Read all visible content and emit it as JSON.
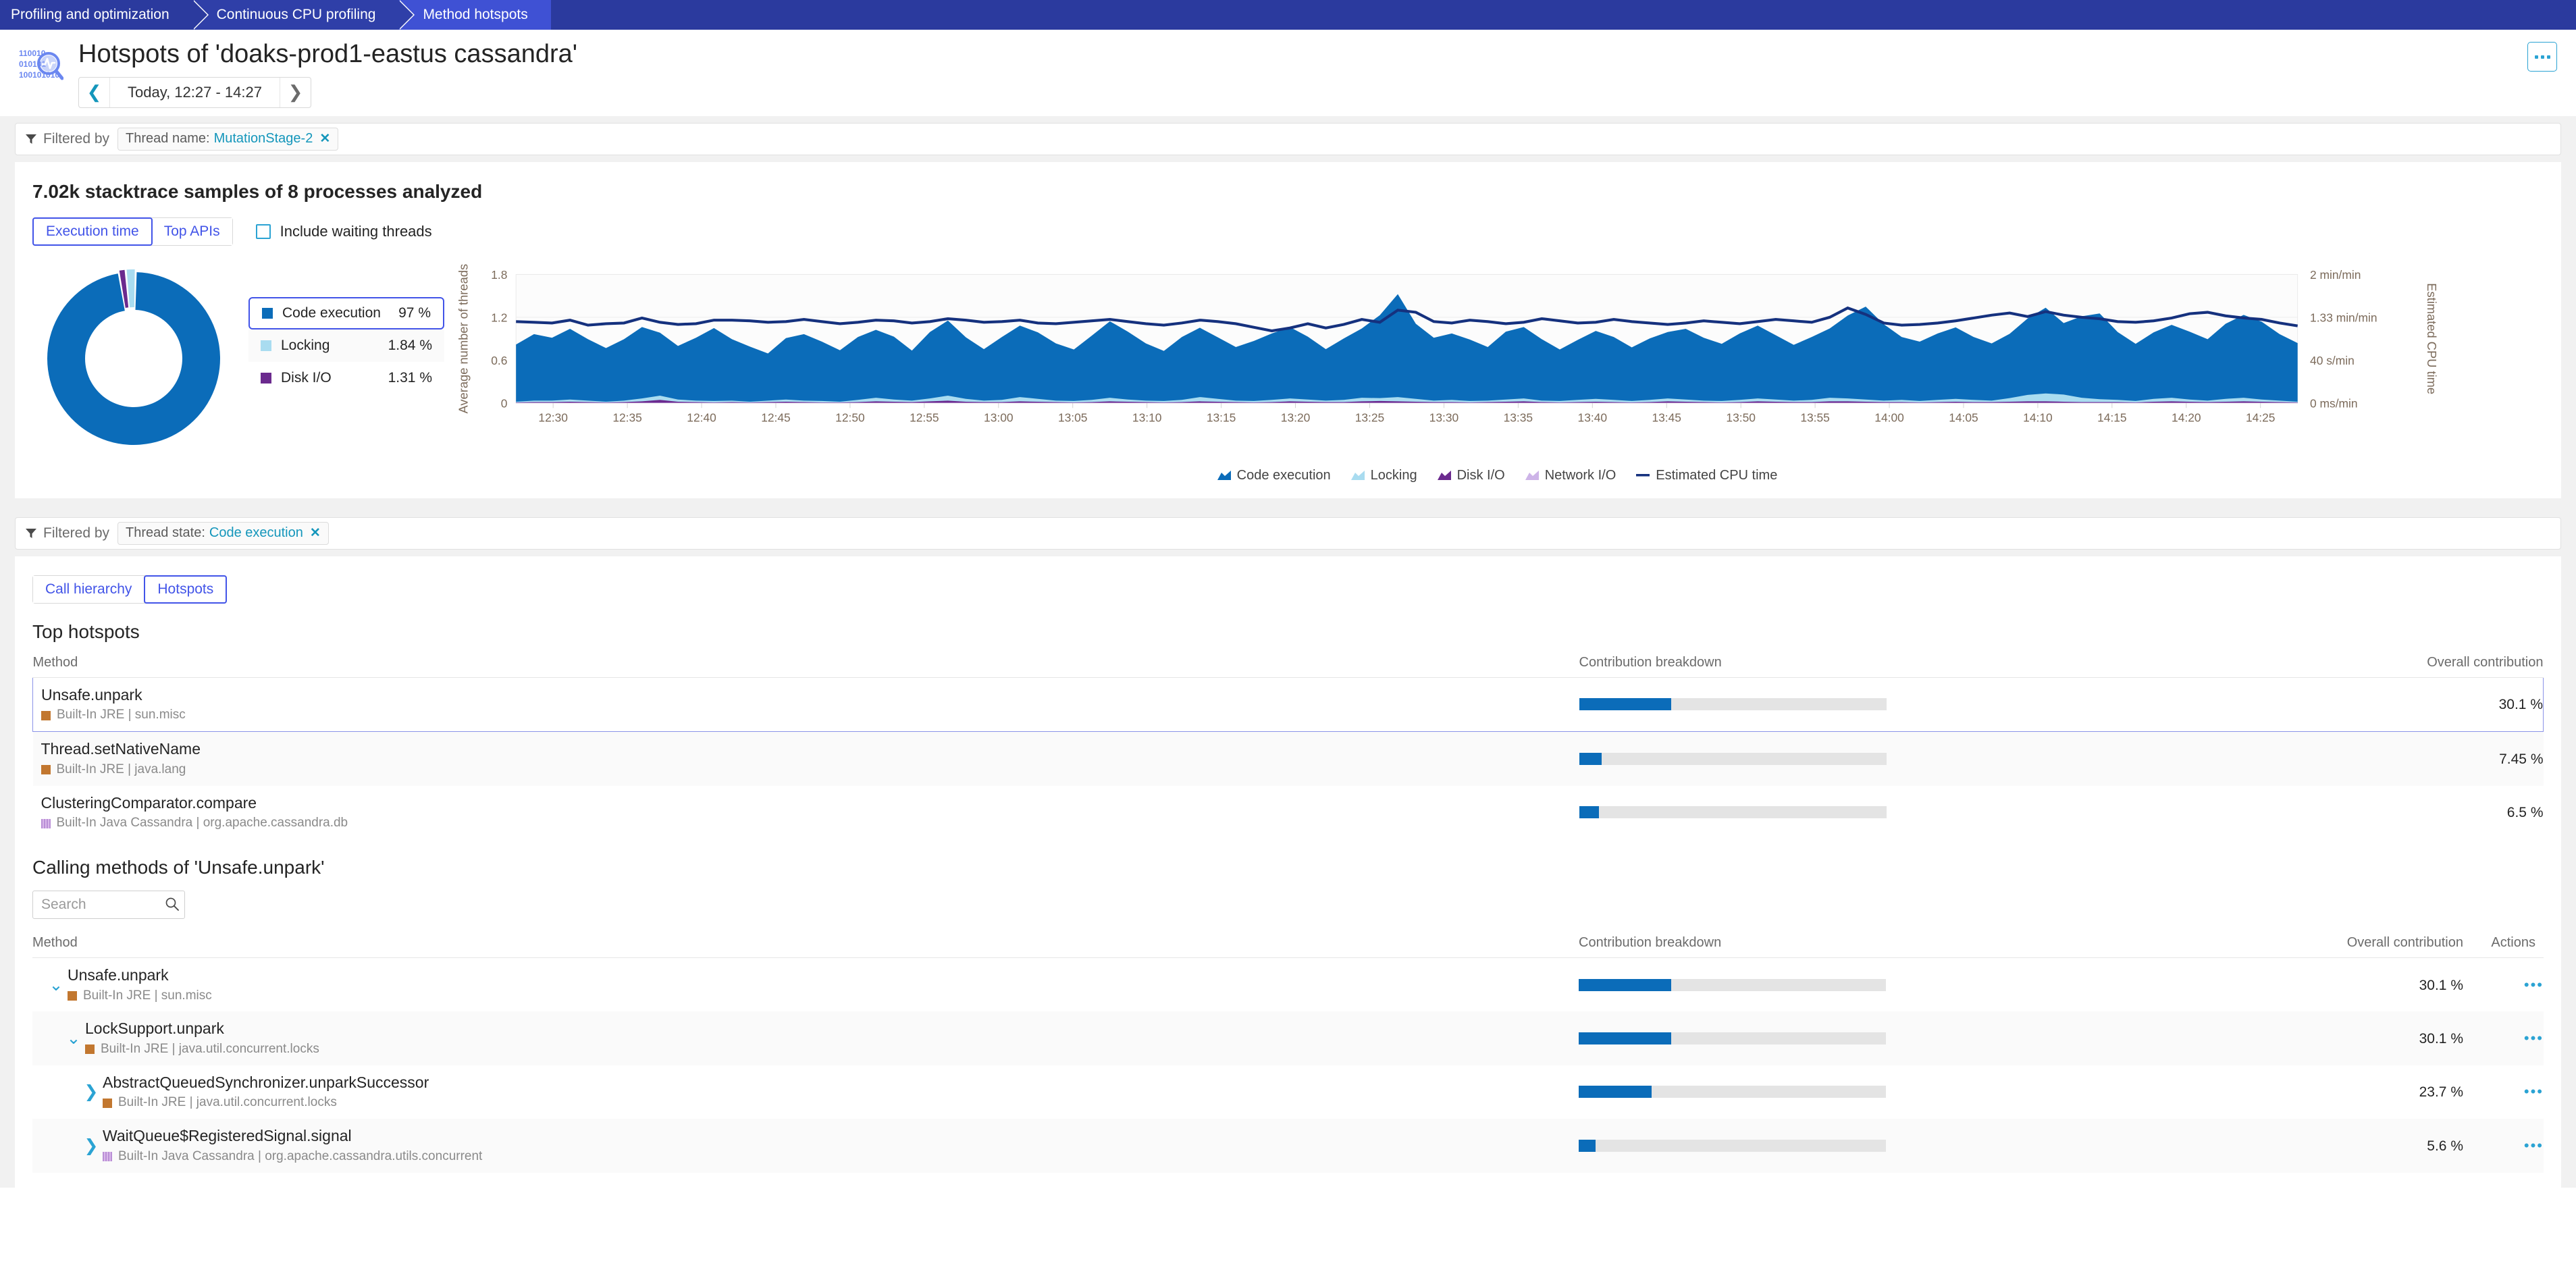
{
  "breadcrumb": {
    "items": [
      {
        "label": "Profiling and optimization"
      },
      {
        "label": "Continuous CPU profiling"
      },
      {
        "label": "Method hotspots"
      }
    ]
  },
  "header": {
    "title": "Hotspots of 'doaks-prod1-eastus cassandra'",
    "timerange": "Today, 12:27 - 14:27",
    "prev_icon": "chevron-left-icon",
    "next_icon": "chevron-right-icon",
    "kebab_icon": "more-options-icon",
    "logo_icon": "profiling-magnifier-icon"
  },
  "filter_top": {
    "label": "Filtered by",
    "icon": "funnel-icon",
    "chip_key": "Thread name:",
    "chip_value": "MutationStage-2",
    "chip_remove": "✕"
  },
  "filter_mid": {
    "label": "Filtered by",
    "icon": "funnel-icon",
    "chip_key": "Thread state:",
    "chip_value": "Code execution",
    "chip_remove": "✕"
  },
  "summary": {
    "title": "7.02k stacktrace samples of 8 processes analyzed",
    "tabs": [
      {
        "label": "Execution time",
        "active": true
      },
      {
        "label": "Top APIs",
        "active": false
      }
    ],
    "checkbox_label": "Include waiting threads",
    "checkbox_checked": false
  },
  "donut_legend": [
    {
      "label": "Code execution",
      "value": "97 %",
      "color": "#0b6cb9",
      "selected": true
    },
    {
      "label": "Locking",
      "value": "1.84 %",
      "color": "#a9dcf0",
      "selected": false
    },
    {
      "label": "Disk I/O",
      "value": "1.31 %",
      "color": "#6b2a8e",
      "selected": false
    }
  ],
  "chart_data": {
    "type": "area",
    "title": "",
    "xlabel": "",
    "ylabel": "Average number of threads",
    "y2label": "Estimated CPU time",
    "ylim": [
      0,
      1.8
    ],
    "yticks": [
      "0",
      "0.6",
      "1.2",
      "1.8"
    ],
    "y2ticks": [
      "0 ms/min",
      "40 s/min",
      "1.33 min/min",
      "2 min/min"
    ],
    "grid": true,
    "legend_position": "bottom",
    "legend": [
      {
        "name": "Code execution",
        "color": "#0b6cb9",
        "mark": "area"
      },
      {
        "name": "Locking",
        "color": "#a9dcf0",
        "mark": "area"
      },
      {
        "name": "Disk I/O",
        "color": "#6b2a8e",
        "mark": "area"
      },
      {
        "name": "Network I/O",
        "color": "#cdb4e8",
        "mark": "area"
      },
      {
        "name": "Estimated CPU time",
        "color": "#15317e",
        "mark": "line"
      }
    ],
    "xticks": [
      "12:30",
      "12:35",
      "12:40",
      "12:45",
      "12:50",
      "12:55",
      "13:00",
      "13:05",
      "13:10",
      "13:15",
      "13:20",
      "13:25",
      "13:30",
      "13:35",
      "13:40",
      "13:45",
      "13:50",
      "13:55",
      "14:00",
      "14:05",
      "14:10",
      "14:15",
      "14:20",
      "14:25"
    ],
    "series": [
      {
        "name": "Code execution",
        "color": "#0b6cb9",
        "values": [
          0.8,
          0.93,
          0.88,
          0.99,
          0.86,
          0.75,
          0.86,
          1.0,
          0.88,
          0.75,
          0.88,
          1.02,
          0.86,
          0.77,
          0.66,
          0.86,
          0.93,
          0.83,
          0.72,
          0.88,
          0.95,
          0.88,
          0.7,
          0.93,
          1.05,
          0.86,
          0.72,
          0.88,
          1.0,
          0.93,
          0.8,
          0.72,
          0.9,
          1.07,
          0.95,
          0.8,
          0.7,
          0.88,
          0.97,
          0.86,
          0.75,
          0.84,
          0.93,
          1.0,
          0.88,
          0.72,
          0.86,
          0.97,
          1.16,
          1.44,
          1.05,
          0.88,
          0.93,
          0.86,
          0.75,
          0.95,
          1.0,
          0.86,
          0.72,
          0.84,
          0.95,
          0.88,
          0.75,
          0.86,
          0.93,
          0.99,
          0.88,
          0.8,
          0.93,
          1.02,
          0.9,
          0.78,
          0.88,
          0.97,
          1.16,
          1.3,
          1.07,
          0.88,
          0.83,
          0.93,
          1.0,
          0.88,
          0.8,
          0.9,
          1.07,
          1.2,
          1.0,
          1.14,
          1.2,
          0.95,
          0.8,
          0.93,
          1.02,
          0.95,
          0.86,
          1.05,
          1.16,
          1.09,
          0.93,
          0.82
        ]
      },
      {
        "name": "Locking",
        "color": "#a9dcf0",
        "values": [
          0.01,
          0.02,
          0.02,
          0.03,
          0.02,
          0.01,
          0.02,
          0.04,
          0.06,
          0.03,
          0.02,
          0.02,
          0.02,
          0.01,
          0.02,
          0.03,
          0.02,
          0.02,
          0.01,
          0.03,
          0.05,
          0.03,
          0.02,
          0.04,
          0.07,
          0.04,
          0.02,
          0.03,
          0.06,
          0.04,
          0.02,
          0.02,
          0.03,
          0.05,
          0.03,
          0.02,
          0.02,
          0.03,
          0.06,
          0.04,
          0.02,
          0.02,
          0.03,
          0.04,
          0.03,
          0.02,
          0.03,
          0.05,
          0.04,
          0.06,
          0.04,
          0.02,
          0.03,
          0.02,
          0.02,
          0.03,
          0.04,
          0.02,
          0.02,
          0.03,
          0.04,
          0.03,
          0.02,
          0.03,
          0.04,
          0.03,
          0.02,
          0.02,
          0.03,
          0.04,
          0.03,
          0.02,
          0.03,
          0.05,
          0.04,
          0.03,
          0.02,
          0.03,
          0.02,
          0.03,
          0.04,
          0.03,
          0.02,
          0.05,
          0.09,
          0.11,
          0.1,
          0.06,
          0.04,
          0.03,
          0.02,
          0.04,
          0.05,
          0.03,
          0.02,
          0.04,
          0.05,
          0.03,
          0.02,
          0.01
        ]
      },
      {
        "name": "Disk I/O",
        "color": "#6b2a8e",
        "values": [
          0.005,
          0.01,
          0.01,
          0.015,
          0.01,
          0.005,
          0.01,
          0.02,
          0.04,
          0.015,
          0.01,
          0.005,
          0.01,
          0.005,
          0.01,
          0.015,
          0.01,
          0.005,
          0.005,
          0.01,
          0.02,
          0.015,
          0.01,
          0.02,
          0.03,
          0.015,
          0.01,
          0.01,
          0.02,
          0.015,
          0.01,
          0.005,
          0.01,
          0.02,
          0.015,
          0.01,
          0.005,
          0.01,
          0.02,
          0.015,
          0.01,
          0.005,
          0.01,
          0.02,
          0.015,
          0.01,
          0.01,
          0.02,
          0.025,
          0.02,
          0.015,
          0.01,
          0.01,
          0.005,
          0.01,
          0.015,
          0.02,
          0.01,
          0.005,
          0.01,
          0.015,
          0.01,
          0.005,
          0.01,
          0.02,
          0.015,
          0.01,
          0.005,
          0.01,
          0.02,
          0.015,
          0.01,
          0.01,
          0.02,
          0.02,
          0.015,
          0.01,
          0.01,
          0.005,
          0.01,
          0.015,
          0.01,
          0.01,
          0.015,
          0.02,
          0.02,
          0.015,
          0.01,
          0.01,
          0.01,
          0.005,
          0.015,
          0.02,
          0.015,
          0.01,
          0.015,
          0.02,
          0.015,
          0.01,
          0.005
        ]
      },
      {
        "name": "Network I/O",
        "color": "#cdb4e8",
        "values": [
          0.004,
          0.004,
          0.004,
          0.004,
          0.004,
          0.004,
          0.004,
          0.004,
          0.004,
          0.004,
          0.004,
          0.004,
          0.004,
          0.004,
          0.004,
          0.004,
          0.004,
          0.004,
          0.004,
          0.004,
          0.004,
          0.004,
          0.004,
          0.004,
          0.004,
          0.004,
          0.004,
          0.004,
          0.004,
          0.004,
          0.004,
          0.004,
          0.004,
          0.004,
          0.004,
          0.004,
          0.004,
          0.004,
          0.004,
          0.004,
          0.004,
          0.004,
          0.004,
          0.004,
          0.004,
          0.004,
          0.004,
          0.004,
          0.004,
          0.004,
          0.004,
          0.004,
          0.004,
          0.004,
          0.004,
          0.004,
          0.004,
          0.004,
          0.004,
          0.004,
          0.004,
          0.004,
          0.004,
          0.004,
          0.004,
          0.004,
          0.004,
          0.004,
          0.004,
          0.004,
          0.004,
          0.004,
          0.004,
          0.004,
          0.004,
          0.004,
          0.004,
          0.004,
          0.004,
          0.004,
          0.004,
          0.004,
          0.004,
          0.004,
          0.004,
          0.004,
          0.004,
          0.004,
          0.004,
          0.004,
          0.004,
          0.004,
          0.004,
          0.004,
          0.004,
          0.004,
          0.004,
          0.004,
          0.004,
          0.004
        ]
      },
      {
        "name": "Estimated CPU time",
        "color": "#15317e",
        "line": true,
        "values": [
          1.14,
          1.13,
          1.12,
          1.16,
          1.09,
          1.11,
          1.12,
          1.19,
          1.13,
          1.1,
          1.11,
          1.16,
          1.16,
          1.15,
          1.13,
          1.14,
          1.17,
          1.14,
          1.11,
          1.13,
          1.16,
          1.15,
          1.12,
          1.14,
          1.18,
          1.16,
          1.13,
          1.14,
          1.16,
          1.12,
          1.11,
          1.13,
          1.15,
          1.17,
          1.14,
          1.11,
          1.09,
          1.12,
          1.16,
          1.14,
          1.11,
          1.06,
          1.01,
          1.05,
          1.11,
          1.05,
          1.1,
          1.17,
          1.13,
          1.3,
          1.27,
          1.14,
          1.12,
          1.16,
          1.14,
          1.11,
          1.13,
          1.18,
          1.15,
          1.12,
          1.13,
          1.17,
          1.14,
          1.12,
          1.1,
          1.12,
          1.15,
          1.13,
          1.11,
          1.14,
          1.17,
          1.15,
          1.13,
          1.2,
          1.33,
          1.24,
          1.12,
          1.09,
          1.1,
          1.12,
          1.15,
          1.19,
          1.23,
          1.26,
          1.21,
          1.28,
          1.23,
          1.2,
          1.18,
          1.14,
          1.13,
          1.15,
          1.19,
          1.25,
          1.27,
          1.22,
          1.19,
          1.17,
          1.12,
          1.08
        ]
      }
    ]
  },
  "analysis": {
    "tabs": [
      {
        "label": "Call hierarchy",
        "active": false
      },
      {
        "label": "Hotspots",
        "active": true
      }
    ]
  },
  "top_hotspots": {
    "title": "Top hotspots",
    "columns": {
      "method": "Method",
      "breakdown": "Contribution breakdown",
      "overall": "Overall contribution"
    },
    "rows": [
      {
        "method": "Unsafe.unpark",
        "origin": "Built-In JRE | sun.misc",
        "origin_type": "jre",
        "bar_pct": 30.1,
        "overall": "30.1 %",
        "selected": true
      },
      {
        "method": "Thread.setNativeName",
        "origin": "Built-In JRE | java.lang",
        "origin_type": "jre",
        "bar_pct": 7.45,
        "overall": "7.45 %",
        "selected": false
      },
      {
        "method": "ClusteringComparator.compare",
        "origin": "Built-In Java Cassandra | org.apache.cassandra.db",
        "origin_type": "cass",
        "bar_pct": 6.5,
        "overall": "6.5 %",
        "selected": false
      }
    ]
  },
  "calling_methods": {
    "title": "Calling methods of 'Unsafe.unpark'",
    "search_placeholder": "Search",
    "search_value": "",
    "search_icon": "search-icon",
    "columns": {
      "method": "Method",
      "breakdown": "Contribution breakdown",
      "overall": "Overall contribution",
      "actions": "Actions"
    },
    "rows": [
      {
        "method": "Unsafe.unpark",
        "origin": "Built-In JRE | sun.misc",
        "origin_type": "jre",
        "indent": 0,
        "chevron": "down",
        "bar_pct": 30.1,
        "overall": "30.1 %",
        "actions": "•••"
      },
      {
        "method": "LockSupport.unpark",
        "origin": "Built-In JRE | java.util.concurrent.locks",
        "origin_type": "jre",
        "indent": 1,
        "chevron": "down",
        "bar_pct": 30.1,
        "overall": "30.1 %",
        "actions": "•••"
      },
      {
        "method": "AbstractQueuedSynchronizer.unparkSuccessor",
        "origin": "Built-In JRE | java.util.concurrent.locks",
        "origin_type": "jre",
        "indent": 2,
        "chevron": "right",
        "bar_pct": 23.7,
        "overall": "23.7 %",
        "actions": "•••"
      },
      {
        "method": "WaitQueue$RegisteredSignal.signal",
        "origin": "Built-In Java Cassandra | org.apache.cassandra.utils.concurrent",
        "origin_type": "cass",
        "indent": 2,
        "chevron": "right",
        "bar_pct": 5.6,
        "overall": "5.6 %",
        "actions": "•••"
      }
    ]
  },
  "colors": {
    "brand_blue": "#2b3a9e",
    "accent_blue": "#4254e8",
    "cyan": "#2ba3d3",
    "series_code": "#0b6cb9",
    "series_locking": "#a9dcf0",
    "series_disk": "#6b2a8e",
    "series_network": "#cdb4e8",
    "series_cpu": "#15317e"
  }
}
